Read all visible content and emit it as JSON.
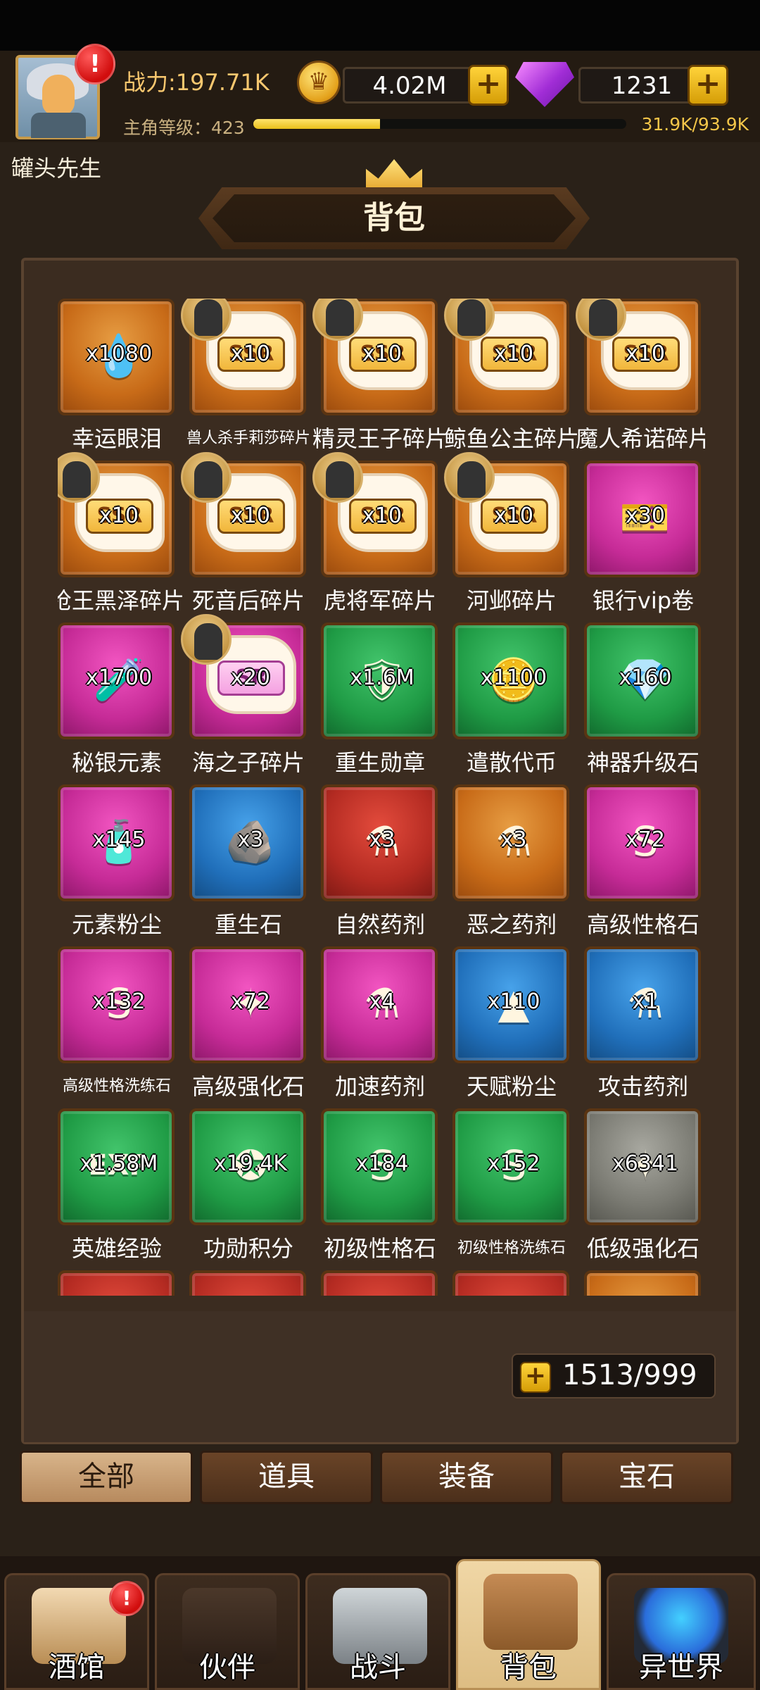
{
  "player": {
    "name": "罐头先生",
    "power": "战力:197.71K",
    "gold": "4.02M",
    "gems": "1231",
    "level_label": "主角等级：423",
    "xp": "31.9K/93.9K",
    "xp_fraction": 0.34,
    "alert": "!"
  },
  "page": {
    "title": "背包"
  },
  "colors": {
    "accent_gold": "#f4c649",
    "panel": "#3b2c20"
  },
  "items": [
    {
      "name": "幸运眼泪",
      "qty": "x1080",
      "color": "orange",
      "icon": "💧"
    },
    {
      "name": "兽人杀手莉莎碎片",
      "qty": "x10",
      "color": "orange",
      "shard": "SSR",
      "hero": true
    },
    {
      "name": "精灵王子碎片",
      "qty": "x10",
      "color": "orange",
      "shard": "SSR",
      "hero": true
    },
    {
      "name": "鲸鱼公主碎片",
      "qty": "x10",
      "color": "orange",
      "shard": "SSR",
      "hero": true
    },
    {
      "name": "魔人希诺碎片",
      "qty": "x10",
      "color": "orange",
      "shard": "SSR",
      "hero": true
    },
    {
      "name": "枪王黑泽碎片",
      "qty": "x10",
      "color": "orange",
      "shard": "SSR",
      "hero": true
    },
    {
      "name": "死音后碎片",
      "qty": "x10",
      "color": "orange",
      "shard": "SSR",
      "hero": true
    },
    {
      "name": "虎将军碎片",
      "qty": "x10",
      "color": "orange",
      "shard": "SSR",
      "hero": true
    },
    {
      "name": "河邺碎片",
      "qty": "x10",
      "color": "orange",
      "shard": "SSR",
      "hero": true
    },
    {
      "name": "银行vip卷",
      "qty": "x30",
      "color": "pink",
      "icon": "🎫"
    },
    {
      "name": "秘银元素",
      "qty": "x1700",
      "color": "pink",
      "icon": "🧪"
    },
    {
      "name": "海之子碎片",
      "qty": "x20",
      "color": "pink",
      "shard": "SR",
      "hero": true
    },
    {
      "name": "重生勋章",
      "qty": "x1.6M",
      "color": "green",
      "icon": "🛡"
    },
    {
      "name": "遣散代币",
      "qty": "x1100",
      "color": "green",
      "icon": "🪙"
    },
    {
      "name": "神器升级石",
      "qty": "x160",
      "color": "green",
      "icon": "💎"
    },
    {
      "name": "元素粉尘",
      "qty": "x145",
      "color": "pink",
      "icon": "🧴"
    },
    {
      "name": "重生石",
      "qty": "x3",
      "color": "blue",
      "icon": "🪨"
    },
    {
      "name": "自然药剂",
      "qty": "x3",
      "color": "red",
      "icon": "⚗"
    },
    {
      "name": "恶之药剂",
      "qty": "x3",
      "color": "orange",
      "icon": "⚗"
    },
    {
      "name": "高级性格石",
      "qty": "x72",
      "color": "pink",
      "icon": "S"
    },
    {
      "name": "高级性格洗练石",
      "qty": "x132",
      "color": "pink",
      "icon": "S"
    },
    {
      "name": "高级强化石",
      "qty": "x72",
      "color": "pink",
      "icon": "✦"
    },
    {
      "name": "加速药剂",
      "qty": "x4",
      "color": "pink",
      "icon": "⚗"
    },
    {
      "name": "天赋粉尘",
      "qty": "x110",
      "color": "blue",
      "icon": "▲"
    },
    {
      "name": "攻击药剂",
      "qty": "x1",
      "color": "blue",
      "icon": "⚗"
    },
    {
      "name": "英雄经验",
      "qty": "x1.58M",
      "color": "green",
      "icon": "EXP"
    },
    {
      "name": "功勋积分",
      "qty": "x19.4K",
      "color": "green",
      "icon": "✪"
    },
    {
      "name": "初级性格石",
      "qty": "x184",
      "color": "green",
      "icon": "S"
    },
    {
      "name": "初级性格洗练石",
      "qty": "x152",
      "color": "green",
      "icon": "S"
    },
    {
      "name": "低级强化石",
      "qty": "x6341",
      "color": "gray",
      "icon": "✦"
    },
    {
      "name": "",
      "qty": "",
      "color": "red",
      "icon": ""
    },
    {
      "name": "",
      "qty": "",
      "color": "red",
      "icon": ""
    },
    {
      "name": "",
      "qty": "",
      "color": "red",
      "icon": ""
    },
    {
      "name": "",
      "qty": "",
      "color": "red",
      "icon": ""
    },
    {
      "name": "",
      "qty": "",
      "color": "orange",
      "icon": ""
    }
  ],
  "capacity": {
    "text": "1513/999",
    "plus": "+"
  },
  "tabs": [
    "全部",
    "道具",
    "装备",
    "宝石"
  ],
  "nav": [
    {
      "label": "酒馆",
      "icon": "tavern-icon"
    },
    {
      "label": "伙伴",
      "icon": "partner-icon"
    },
    {
      "label": "战斗",
      "icon": "battle-icon"
    },
    {
      "label": "背包",
      "icon": "bag-icon"
    },
    {
      "label": "异世界",
      "icon": "otherworld-icon"
    }
  ]
}
